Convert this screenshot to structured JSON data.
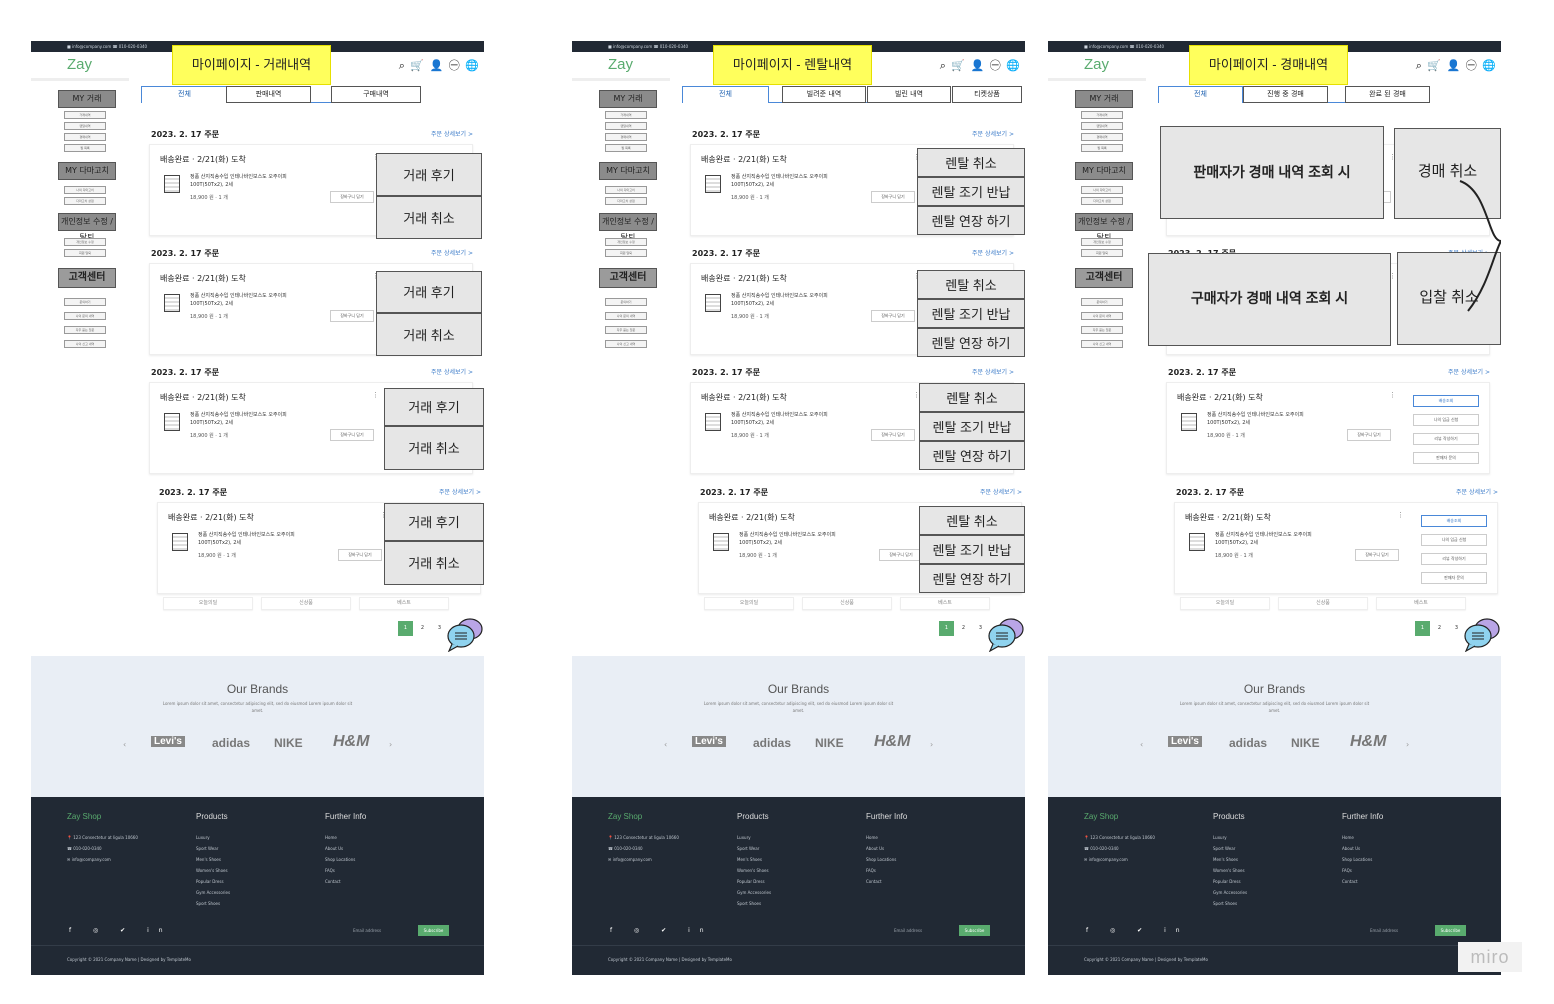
{
  "topbar": {
    "text": "■ info@company.com  ☎ 010-020-0340",
    "icons": "f ◎ ✔ in"
  },
  "logo": "Zay",
  "top_icons": "⌕ 🛒 👤 ㊀ 🌐",
  "panels": [
    {
      "title": "마이페이지 - 거래내역",
      "tabs": [
        "전체",
        "판매내역",
        "구매내역"
      ]
    },
    {
      "title": "마이페이지 - 렌탈내역",
      "tabs": [
        "전체",
        "빌려준 내역",
        "빌린 내역",
        "티켓상품"
      ]
    },
    {
      "title": "마이페이지 - 경매내역",
      "tabs": [
        "전체",
        "진행 중 경매",
        "완료 된 경매"
      ]
    }
  ],
  "sidebar": {
    "groups": [
      "MY 거래",
      "MY 다마고치",
      "개인정보 수정 / 탈퇴",
      "고객센터"
    ],
    "items_trade": [
      "거래내역",
      "렌탈내역",
      "경매내역",
      "찜 목록"
    ],
    "items_tama": [
      "나의 다마고치",
      "다마고치 상점"
    ],
    "items_info": [
      "개인정보 수정",
      "회원 탈퇴"
    ],
    "items_cs": [
      "문의하기",
      "나의 문의 내역",
      "자주 묻는 질문",
      "나의 신고 내역"
    ]
  },
  "order": {
    "date": "2023. 2. 17 주문",
    "detail_link": "주문 상세보기 >",
    "status": "배송완료 · 2/21(화) 도착",
    "product": "정품 산지직송수입 인테나바인보스도 오주이피",
    "product2": "100T(50Tx2), 2세",
    "price": "18,900 원 · 1 개",
    "cart": "장바구니 담기",
    "more": "⋮"
  },
  "trade_actions": [
    "거래 후기",
    "거래 취소"
  ],
  "rental_actions": [
    "렌탈 취소",
    "렌탈 조기 반납",
    "렌탈 연장 하기"
  ],
  "auction": {
    "seller_label": "판매자가 경매 내역 조회 시",
    "seller_action": "경매 취소",
    "buyer_label": "구매자가 경매 내역 조회 시",
    "buyer_action": "입찰 취소",
    "small_actions": [
      "배송조회",
      "나의 입금 신청",
      "리뷰 작성하기",
      "판매자 문의"
    ]
  },
  "bottom_tabs": [
    "오늘의딜",
    "신상품",
    "베스트"
  ],
  "pages": [
    "1",
    "2",
    "3"
  ],
  "brands": {
    "title": "Our Brands",
    "subtitle": "Lorem ipsum dolor sit amet, consectetur adipiscing elit, sed do eiusmod Lorem ipsum dolor sit amet.",
    "logos": [
      "Levi's",
      "adidas",
      "NIKE",
      "H&M"
    ],
    "prev": "‹",
    "next": "›"
  },
  "footer": {
    "shop": "Zay Shop",
    "shop_lines": [
      "📍 123 Consectetur at ligula 10660",
      "☎ 010-020-0340",
      "✉ info@company.com"
    ],
    "products_title": "Products",
    "products": [
      "Luxury",
      "Sport Wear",
      "Men's Shoes",
      "Women's Shoes",
      "Popular Dress",
      "Gym Accessories",
      "Sport Shoes"
    ],
    "info_title": "Further Info",
    "info": [
      "Home",
      "About Us",
      "Shop Locations",
      "FAQs",
      "Contact"
    ],
    "social": "f ◎ ✔ in",
    "email_placeholder": "Email address",
    "subscribe": "Subscribe",
    "copyright": "Copyright © 2021 Company Name | Designed by TemplateMo"
  },
  "watermark": "miro",
  "colors": {
    "accent": "#59ab6e",
    "note": "#ffff5c",
    "footer": "#212934",
    "brands": "#e9eef5",
    "link": "#3a7ac8"
  }
}
